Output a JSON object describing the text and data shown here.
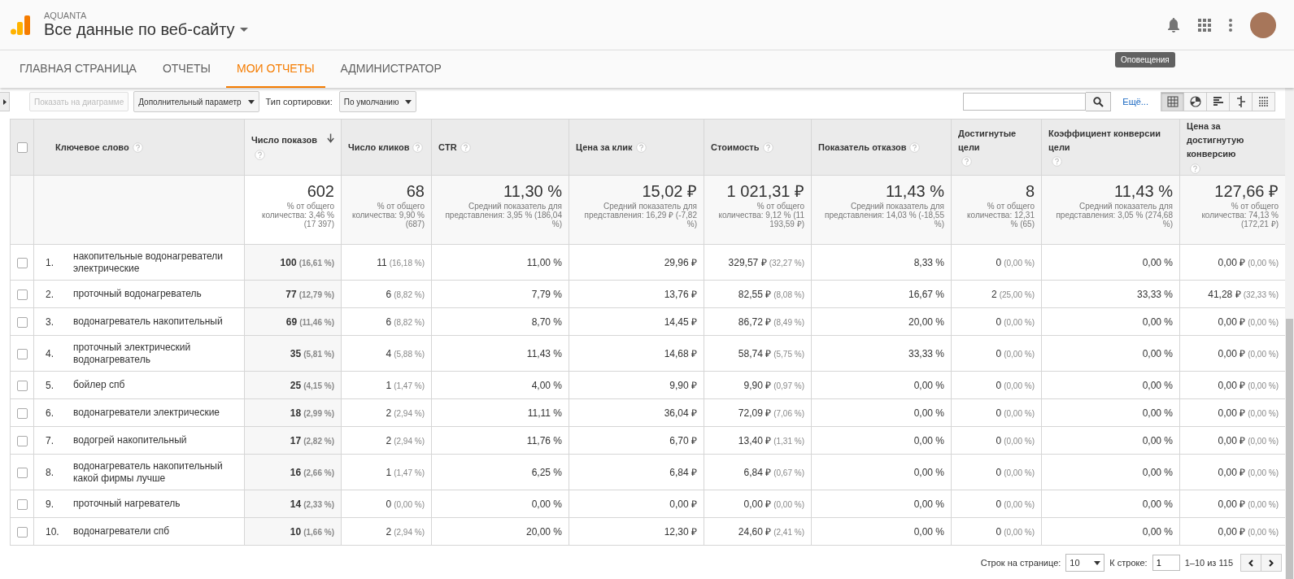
{
  "header": {
    "account": "AQUANTA",
    "view": "Все данные по веб-сайту",
    "tooltip": "Оповещения"
  },
  "tabs": [
    {
      "label": "ГЛАВНАЯ СТРАНИЦА",
      "selected": false
    },
    {
      "label": "ОТЧЕТЫ",
      "selected": false
    },
    {
      "label": "МОИ ОТЧЕТЫ",
      "selected": true
    },
    {
      "label": "АДМИНИСТРАТОР",
      "selected": false
    }
  ],
  "toolbar": {
    "chart_button": {
      "label": "Показать на диаграмме",
      "disabled": true
    },
    "secondary_dimension": "Дополнительный параметр",
    "sort_label": "Тип сортировки:",
    "sort_value": "По умолчанию",
    "more_link": "Ещё...",
    "views": [
      {
        "kind": "table",
        "selected": true
      },
      {
        "kind": "pie",
        "selected": false
      },
      {
        "kind": "bars",
        "selected": false
      },
      {
        "kind": "compare",
        "selected": false
      },
      {
        "kind": "pivot",
        "selected": false
      }
    ]
  },
  "table": {
    "select_all_checked": false,
    "columns": [
      {
        "label": "Ключевое слово",
        "sorted": false
      },
      {
        "label": "Число показов",
        "sorted": true
      },
      {
        "label": "Число кликов",
        "sorted": false
      },
      {
        "label": "CTR",
        "sorted": false
      },
      {
        "label": "Цена за клик",
        "sorted": false
      },
      {
        "label": "Стоимость",
        "sorted": false
      },
      {
        "label": "Показатель отказов",
        "sorted": false
      },
      {
        "label": "Достигнутые цели",
        "sorted": false
      },
      {
        "label": "Коэффициент конверсии цели",
        "sorted": false
      },
      {
        "label": "Цена за достигнутую конверсию",
        "sorted": false
      }
    ],
    "summary": [
      {
        "value": "602",
        "note": "% от общего количества: 3,46 % (17 397)"
      },
      {
        "value": "68",
        "note": "% от общего количества: 9,90 % (687)"
      },
      {
        "value": "11,30 %",
        "note": "Средний показатель для представления: 3,95 % (186,04 %)"
      },
      {
        "value": "15,02 ₽",
        "note": "Средний показатель для представления: 16,29 ₽ (-7,82 %)"
      },
      {
        "value": "1 021,31 ₽",
        "note": "% от общего количества: 9,12 % (11 193,59 ₽)"
      },
      {
        "value": "11,43 %",
        "note": "Средний показатель для представления: 14,03 % (-18,55 %)"
      },
      {
        "value": "8",
        "note": "% от общего количества: 12,31 % (65)"
      },
      {
        "value": "11,43 %",
        "note": "Средний показатель для представления: 3,05 % (274,68 %)"
      },
      {
        "value": "127,66 ₽",
        "note": "% от общего количества: 74,13 % (172,21 ₽)"
      }
    ],
    "rows": [
      {
        "selected": false,
        "cells": [
          {
            "number": "1.",
            "value": "накопительные водонагреватели электрические"
          },
          {
            "value": "100",
            "share": "(16,61 %)"
          },
          {
            "value": "11",
            "share": "(16,18 %)"
          },
          {
            "value": "11,00 %"
          },
          {
            "value": "29,96 ₽"
          },
          {
            "value": "329,57 ₽",
            "share": "(32,27 %)"
          },
          {
            "value": "8,33 %"
          },
          {
            "value": "0",
            "share": "(0,00 %)"
          },
          {
            "value": "0,00 %"
          },
          {
            "value": "0,00 ₽",
            "share": "(0,00 %)"
          }
        ]
      },
      {
        "selected": false,
        "cells": [
          {
            "number": "2.",
            "value": "проточный водонагреватель"
          },
          {
            "value": "77",
            "share": "(12,79 %)"
          },
          {
            "value": "6",
            "share": "(8,82 %)"
          },
          {
            "value": "7,79 %"
          },
          {
            "value": "13,76 ₽"
          },
          {
            "value": "82,55 ₽",
            "share": "(8,08 %)"
          },
          {
            "value": "16,67 %"
          },
          {
            "value": "2",
            "share": "(25,00 %)"
          },
          {
            "value": "33,33 %"
          },
          {
            "value": "41,28 ₽",
            "share": "(32,33 %)"
          }
        ]
      },
      {
        "selected": false,
        "cells": [
          {
            "number": "3.",
            "value": "водонагреватель накопительный"
          },
          {
            "value": "69",
            "share": "(11,46 %)"
          },
          {
            "value": "6",
            "share": "(8,82 %)"
          },
          {
            "value": "8,70 %"
          },
          {
            "value": "14,45 ₽"
          },
          {
            "value": "86,72 ₽",
            "share": "(8,49 %)"
          },
          {
            "value": "20,00 %"
          },
          {
            "value": "0",
            "share": "(0,00 %)"
          },
          {
            "value": "0,00 %"
          },
          {
            "value": "0,00 ₽",
            "share": "(0,00 %)"
          }
        ]
      },
      {
        "selected": false,
        "cells": [
          {
            "number": "4.",
            "value": "проточный электрический водонагреватель"
          },
          {
            "value": "35",
            "share": "(5,81 %)"
          },
          {
            "value": "4",
            "share": "(5,88 %)"
          },
          {
            "value": "11,43 %"
          },
          {
            "value": "14,68 ₽"
          },
          {
            "value": "58,74 ₽",
            "share": "(5,75 %)"
          },
          {
            "value": "33,33 %"
          },
          {
            "value": "0",
            "share": "(0,00 %)"
          },
          {
            "value": "0,00 %"
          },
          {
            "value": "0,00 ₽",
            "share": "(0,00 %)"
          }
        ]
      },
      {
        "selected": false,
        "cells": [
          {
            "number": "5.",
            "value": "бойлер спб"
          },
          {
            "value": "25",
            "share": "(4,15 %)"
          },
          {
            "value": "1",
            "share": "(1,47 %)"
          },
          {
            "value": "4,00 %"
          },
          {
            "value": "9,90 ₽"
          },
          {
            "value": "9,90 ₽",
            "share": "(0,97 %)"
          },
          {
            "value": "0,00 %"
          },
          {
            "value": "0",
            "share": "(0,00 %)"
          },
          {
            "value": "0,00 %"
          },
          {
            "value": "0,00 ₽",
            "share": "(0,00 %)"
          }
        ]
      },
      {
        "selected": false,
        "cells": [
          {
            "number": "6.",
            "value": "водонагреватели электрические"
          },
          {
            "value": "18",
            "share": "(2,99 %)"
          },
          {
            "value": "2",
            "share": "(2,94 %)"
          },
          {
            "value": "11,11 %"
          },
          {
            "value": "36,04 ₽"
          },
          {
            "value": "72,09 ₽",
            "share": "(7,06 %)"
          },
          {
            "value": "0,00 %"
          },
          {
            "value": "0",
            "share": "(0,00 %)"
          },
          {
            "value": "0,00 %"
          },
          {
            "value": "0,00 ₽",
            "share": "(0,00 %)"
          }
        ]
      },
      {
        "selected": false,
        "cells": [
          {
            "number": "7.",
            "value": "водогрей накопительный"
          },
          {
            "value": "17",
            "share": "(2,82 %)"
          },
          {
            "value": "2",
            "share": "(2,94 %)"
          },
          {
            "value": "11,76 %"
          },
          {
            "value": "6,70 ₽"
          },
          {
            "value": "13,40 ₽",
            "share": "(1,31 %)"
          },
          {
            "value": "0,00 %"
          },
          {
            "value": "0",
            "share": "(0,00 %)"
          },
          {
            "value": "0,00 %"
          },
          {
            "value": "0,00 ₽",
            "share": "(0,00 %)"
          }
        ]
      },
      {
        "selected": false,
        "cells": [
          {
            "number": "8.",
            "value": "водонагреватель накопительный какой фирмы лучше"
          },
          {
            "value": "16",
            "share": "(2,66 %)"
          },
          {
            "value": "1",
            "share": "(1,47 %)"
          },
          {
            "value": "6,25 %"
          },
          {
            "value": "6,84 ₽"
          },
          {
            "value": "6,84 ₽",
            "share": "(0,67 %)"
          },
          {
            "value": "0,00 %"
          },
          {
            "value": "0",
            "share": "(0,00 %)"
          },
          {
            "value": "0,00 %"
          },
          {
            "value": "0,00 ₽",
            "share": "(0,00 %)"
          }
        ]
      },
      {
        "selected": false,
        "cells": [
          {
            "number": "9.",
            "value": "проточный нагреватель"
          },
          {
            "value": "14",
            "share": "(2,33 %)"
          },
          {
            "value": "0",
            "share": "(0,00 %)"
          },
          {
            "value": "0,00 %"
          },
          {
            "value": "0,00 ₽"
          },
          {
            "value": "0,00 ₽",
            "share": "(0,00 %)"
          },
          {
            "value": "0,00 %"
          },
          {
            "value": "0",
            "share": "(0,00 %)"
          },
          {
            "value": "0,00 %"
          },
          {
            "value": "0,00 ₽",
            "share": "(0,00 %)"
          }
        ]
      },
      {
        "selected": false,
        "cells": [
          {
            "number": "10.",
            "value": "водонагреватели спб"
          },
          {
            "value": "10",
            "share": "(1,66 %)"
          },
          {
            "value": "2",
            "share": "(2,94 %)"
          },
          {
            "value": "20,00 %"
          },
          {
            "value": "12,30 ₽"
          },
          {
            "value": "24,60 ₽",
            "share": "(2,41 %)"
          },
          {
            "value": "0,00 %"
          },
          {
            "value": "0",
            "share": "(0,00 %)"
          },
          {
            "value": "0,00 %"
          },
          {
            "value": "0,00 ₽",
            "share": "(0,00 %)"
          }
        ]
      }
    ]
  },
  "pager": {
    "rows_label": "Строк на странице:",
    "rows_value": "10",
    "goto_label": "К строке:",
    "goto_value": "1",
    "range": "1–10 из 115"
  }
}
